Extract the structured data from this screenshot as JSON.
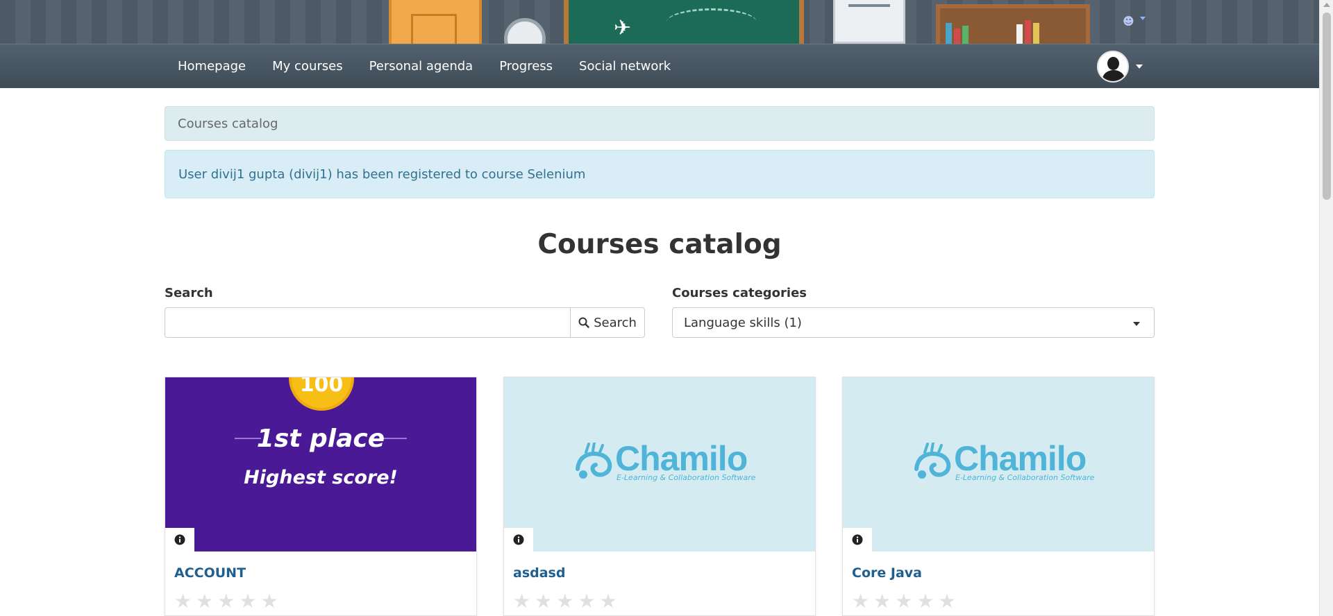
{
  "nav": {
    "items": [
      {
        "label": "Homepage"
      },
      {
        "label": "My courses"
      },
      {
        "label": "Personal agenda"
      },
      {
        "label": "Progress"
      },
      {
        "label": "Social network"
      }
    ]
  },
  "breadcrumb": {
    "current": "Courses catalog"
  },
  "alert": {
    "message": "User divij1 gupta (divij1) has been registered to course Selenium"
  },
  "page": {
    "title": "Courses catalog"
  },
  "search": {
    "label": "Search",
    "value": "",
    "button_label": "Search"
  },
  "categories": {
    "label": "Courses categories",
    "selected": "Language skills (1)"
  },
  "banner_art": {
    "medal_text": "100",
    "place_text": "1st place",
    "highest_text": "Highest score!",
    "logo_word": "Chamilo",
    "logo_tagline": "E-Learning & Collaboration Software"
  },
  "courses": [
    {
      "title": "ACCOUNT",
      "thumbnail": "first-place-badge",
      "rating": 0,
      "max_rating": 5
    },
    {
      "title": "asdasd",
      "thumbnail": "chamilo-logo",
      "rating": 0,
      "max_rating": 5
    },
    {
      "title": "Core Java",
      "thumbnail": "chamilo-logo",
      "rating": 0,
      "max_rating": 5
    }
  ],
  "colors": {
    "navbar": "#4a5864",
    "alert_bg": "#d9edf7",
    "alert_text": "#31708f",
    "breadcrumb_bg": "#dcecef",
    "link": "#1f5f8f",
    "chamilo_blue": "#4fb4d8",
    "purple": "#4a1a96"
  },
  "icons": {
    "search": "search-icon",
    "info": "info-icon",
    "star": "star-icon",
    "user": "user-icon"
  }
}
